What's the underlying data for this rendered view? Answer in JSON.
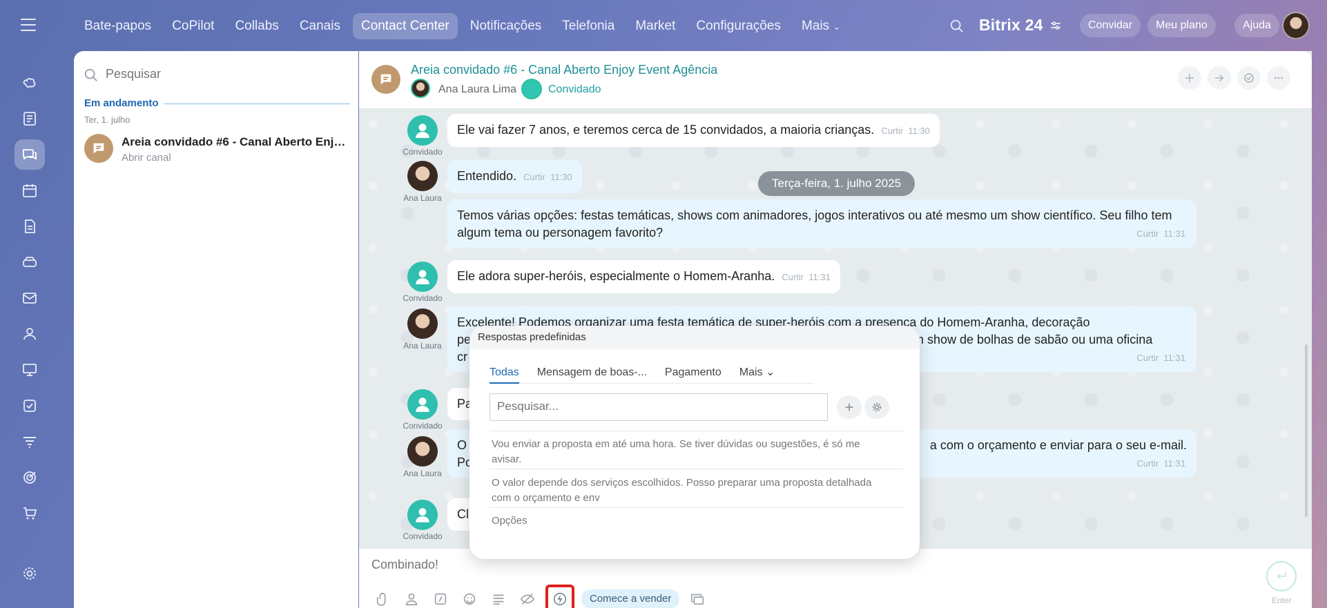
{
  "topbar": {
    "nav": [
      "Bate-papos",
      "CoPilot",
      "Collabs",
      "Canais",
      "Contact Center",
      "Notificações",
      "Telefonia",
      "Market",
      "Configurações",
      "Mais"
    ],
    "active_nav_index": 4,
    "brand": "Bitrix 24",
    "invite_label": "Convidar",
    "plan_label": "Meu plano",
    "help_label": "Ajuda"
  },
  "rail": {
    "icons": [
      "copilot-icon",
      "feed-icon",
      "chat-icon",
      "calendar-icon",
      "docs-icon",
      "drive-icon",
      "mail-icon",
      "contacts-icon",
      "training-icon",
      "tasks-icon",
      "crm-icon",
      "goals-icon",
      "shop-icon",
      "settings-icon"
    ],
    "active_index": 2
  },
  "list": {
    "search_placeholder": "Pesquisar",
    "section": "Em andamento",
    "day": "Ter, 1. julho",
    "chat_title": "Areia convidado #6 - Canal Aberto Enjoy Event Agência",
    "chat_sub": "Abrir canal"
  },
  "chat": {
    "title": "Areia convidado #6 - Canal Aberto Enjoy Event Agência",
    "agent_name": "Ana Laura Lima",
    "guest_role": "Convidado",
    "date_pill": "Terça-feira, 1. julho 2025",
    "like_label": "Curtir",
    "guest_label": "Convidado",
    "agent_label": "Ana Laura",
    "messages": [
      {
        "text": "Ele vai fazer 7 anos, e teremos cerca de 15 convidados, a maioria crianças.",
        "time": "11:30"
      },
      {
        "text": "Entendido.",
        "time": "11:30"
      },
      {
        "text": "Temos várias opções: festas temáticas, shows com animadores, jogos interativos ou até mesmo um show científico. Seu filho tem algum tema ou personagem favorito?",
        "time": "11:31"
      },
      {
        "text": "Ele adora super-heróis, especialmente o Homem-Aranha.",
        "time": "11:31"
      },
      {
        "text_line1": "Excelente! Podemos organizar uma festa temática de super-heróis com a presença do Homem-Aranha, decoração",
        "text_line2_start": "pe",
        "text_line2_end": "r um show de bolhas de sabão ou uma oficina",
        "text_line3": "cr",
        "time": "11:31"
      },
      {
        "text": "Pa"
      },
      {
        "text_line1_start": "O",
        "text_line1_end": "a com o orçamento e enviar para o seu e-mail.",
        "text_line2": "Po",
        "time": "11:31"
      },
      {
        "text": "Cl"
      }
    ]
  },
  "composer": {
    "placeholder": "Combinado!",
    "sell_label": "Comece a vender",
    "send_hint": "Enter"
  },
  "popup": {
    "title": "Respostas predefinidas",
    "tabs": [
      "Todas",
      "Mensagem de boas-...",
      "Pagamento",
      "Mais"
    ],
    "search_placeholder": "Pesquisar...",
    "items": [
      "Vou enviar a proposta em até uma hora. Se tiver dúvidas ou sugestões, é só me avisar.",
      "O valor depende dos serviços escolhidos. Posso preparar uma proposta detalhada com o orçamento e env"
    ],
    "options_label": "Opções"
  }
}
